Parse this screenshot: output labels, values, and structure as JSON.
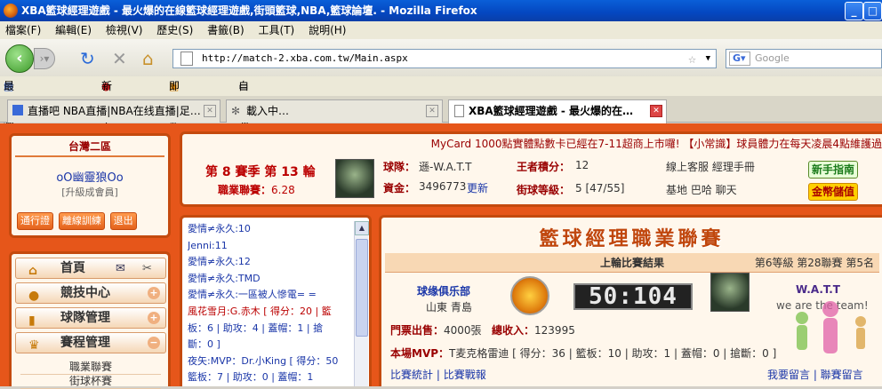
{
  "window": {
    "title": "XBA籃球經理遊戲 - 最火爆的在線籃球經理遊戲,街頭籃球,NBA,籃球論壇. - Mozilla Firefox"
  },
  "menu": [
    "檔案(F)",
    "編輯(E)",
    "檢視(V)",
    "歷史(S)",
    "書籤(B)",
    "工具(T)",
    "說明(H)"
  ],
  "nav": {
    "url": "http://match-2.xba.com.tw/Main.aspx",
    "search_placeholder": "Google"
  },
  "bookmarks": [
    "最常瀏覽的網站",
    "新手上路",
    "即時新聞",
    "自訂連結"
  ],
  "tabs": [
    {
      "label": "直播吧 NBA直播|NBA在线直播|足…"
    },
    {
      "label": "載入中…"
    },
    {
      "label": "XBA籃球經理遊戲 - 最火爆的在…"
    }
  ],
  "user": {
    "server": "台灣二區",
    "name": "oO幽靈狼Oo",
    "level": "[升級成會員]",
    "buttons": [
      "通行證",
      "離線訓練",
      "退出"
    ]
  },
  "sidebar": {
    "items": [
      {
        "label": "首頁",
        "icon": "home-icon"
      },
      {
        "label": "競技中心",
        "icon": "basketball-icon"
      },
      {
        "label": "球隊管理",
        "icon": "jersey-icon"
      },
      {
        "label": "賽程管理",
        "icon": "trophy-icon"
      }
    ],
    "subitems": [
      "職業聯賽",
      "街球杯賽"
    ]
  },
  "info": {
    "marquee": "MyCard 1000點實體點數卡已經在7-11超商上市囉! 【小常識】球員體力在每天凌晨4點維護過",
    "season": "第 8 賽季 第 13 輪",
    "league_points_label": "職業聯賽：",
    "league_points": "6.28",
    "team_label": "球隊：",
    "team": "遜-W.A.T.T",
    "funds_label": "資金：",
    "funds": "3496773",
    "update_link": "更新",
    "king_points_label": "王者積分：",
    "king_points": "12",
    "street_level_label": "街球等級：",
    "street_level": "5 [47/55]",
    "links_row1": "線上客服  經理手冊",
    "links_row2": "基地  巴哈  聊天",
    "newbie_guide": "新手指南",
    "gold_store": "金幣儲值"
  },
  "chat": {
    "lines": [
      "愛情≠永久:10",
      "Jenni:11",
      "愛情≠永久:12",
      "愛情≠永久:TMD",
      "愛情≠永久:一區被人慘電= =",
      "風花雪月:G.赤木 [ 得分：20 | 籃",
      "板：6 | 助攻：4 | 蓋帽：1 | 搶",
      "斷：0 ]",
      "夜矢:MVP：Dr.小King [ 得分：50",
      "籃板：7 | 助攻：0 | 蓋帽：1"
    ]
  },
  "game": {
    "banner": "籃球經理職業聯賽",
    "last_result": "上輪比賽結果",
    "division": "第6等級 第28聯賽 第5名",
    "home_team": "球缘俱乐部",
    "home_location": "山東 青島",
    "score": "50:104",
    "away_team": "W.A.T.T",
    "away_slogan": "we are the team!",
    "tickets_label": "門票出售：",
    "tickets": "4000張",
    "income_label": "總收入：",
    "income": "123995",
    "mvp_label": "本場MVP：",
    "mvp": "T麦克格雷迪 [ 得分：36 | 籃板：10 | 助攻：1 | 蓋帽：0 | 搶斷：0 ]",
    "links": [
      "比賽統計",
      "比賽戰報"
    ],
    "right_links": "我要留言 | 聯賽留言"
  }
}
